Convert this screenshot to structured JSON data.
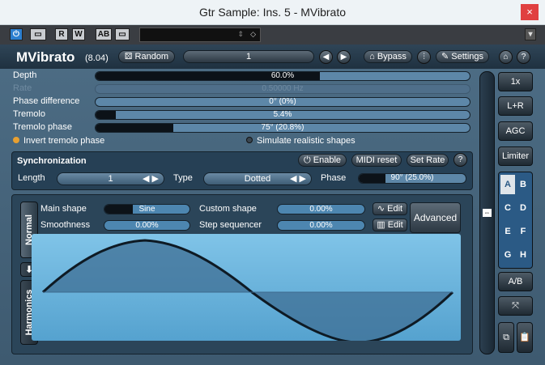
{
  "window": {
    "title": "Gtr Sample: Ins. 5 - MVibrato",
    "close_symbol": "×"
  },
  "host": {
    "power_label": "⏻",
    "compare_label": "▭",
    "read_label": "R",
    "write_label": "W",
    "ab_label": "AB",
    "copy_label": "▭"
  },
  "plugin": {
    "name": "MVibrato",
    "version": "(8.04)",
    "random_label": "Random",
    "preset_number": "1",
    "bypass_label": "Bypass",
    "settings_label": "Settings"
  },
  "params": [
    {
      "label": "Depth",
      "value": "60.0%",
      "level": 0.6,
      "dim": false
    },
    {
      "label": "Rate",
      "value": "0.50000 Hz",
      "level": 0.0,
      "dim": true
    },
    {
      "label": "Phase difference",
      "value": "0° (0%)",
      "level": 0.0,
      "dim": false
    },
    {
      "label": "Tremolo",
      "value": "5.4%",
      "level": 0.054,
      "dim": false
    },
    {
      "label": "Tremolo phase",
      "value": "75° (20.8%)",
      "level": 0.208,
      "dim": false
    }
  ],
  "options": {
    "invert_tremolo_phase": "Invert tremolo phase",
    "simulate_realistic_shapes": "Simulate realistic shapes",
    "invert_on": true,
    "simulate_on": false
  },
  "sync": {
    "title": "Synchronization",
    "enable_label": "Enable",
    "midi_reset_label": "MIDI reset",
    "set_rate_label": "Set Rate",
    "length_label": "Length",
    "length_value": "1",
    "type_label": "Type",
    "type_value": "Dotted",
    "phase_label": "Phase",
    "phase_value": "90° (25.0%)",
    "phase_level": 0.25
  },
  "shape": {
    "tab_normal": "Normal",
    "tab_harmonics": "Harmonics",
    "main_shape_label": "Main shape",
    "main_shape_value": "Sine",
    "custom_shape_label": "Custom shape",
    "custom_shape_value": "0.00%",
    "smoothness_label": "Smoothness",
    "smoothness_value": "0.00%",
    "step_sequencer_label": "Step sequencer",
    "step_sequencer_value": "0.00%",
    "edit_label": "Edit",
    "advanced_label": "Advanced"
  },
  "right": {
    "oversample": "1x",
    "lr": "L+R",
    "agc": "AGC",
    "limiter": "Limiter",
    "ab_slots": [
      "A",
      "B",
      "C",
      "D",
      "E",
      "F",
      "G",
      "H"
    ],
    "ab_compare": "A/B"
  },
  "colors": {
    "accent": "#2c7fd0",
    "invert_dot": "#e8a030",
    "simulate_dot": "#3a4650"
  }
}
